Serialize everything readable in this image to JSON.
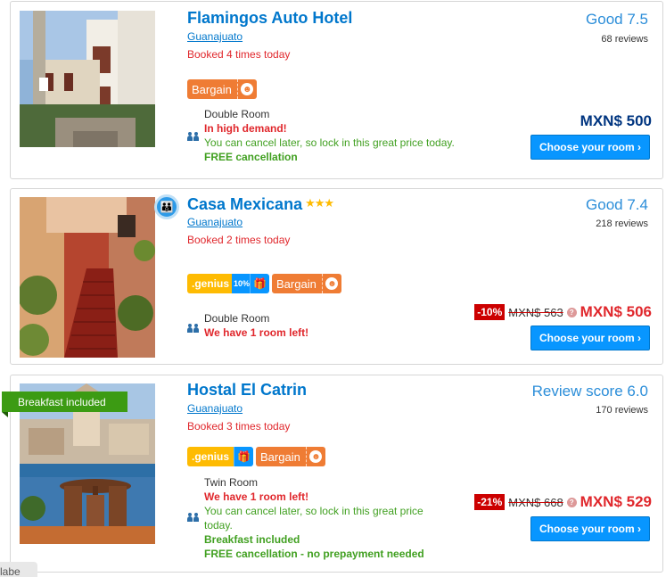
{
  "hotels": [
    {
      "name": "Flamingos Auto Hotel",
      "stars": "",
      "city": "Guanajuato",
      "booked": "Booked 4 times today",
      "score": "Good 7.5",
      "reviews": "68 reviews",
      "room_type": "Double Room",
      "line1": "In high demand!",
      "line2": "You can cancel later, so lock in this great price today.",
      "line3": "FREE cancellation",
      "price": "MXN$ 500",
      "button": "Choose your room ›",
      "bargain": "Bargain"
    },
    {
      "name": "Casa Mexicana",
      "stars": "★★★",
      "city": "Guanajuato",
      "booked": "Booked 2 times today",
      "score": "Good 7.4",
      "reviews": "218 reviews",
      "room_type": "Double Room",
      "line1": "We have 1 room left!",
      "discount": "-10%",
      "old_price": "MXN$ 563",
      "price": "MXN$ 506",
      "button": "Choose your room ›",
      "genius": ".genius",
      "genius_pct": "10%",
      "bargain": "Bargain"
    },
    {
      "name": "Hostal El Catrin",
      "stars": "",
      "city": "Guanajuato",
      "booked": "Booked 3 times today",
      "score": "Review score 6.0",
      "reviews": "170 reviews",
      "ribbon": "Breakfast included",
      "room_type": "Twin Room",
      "line1": "We have 1 room left!",
      "line2": "You can cancel later, so lock in this great price today.",
      "line3": "Breakfast included",
      "line4": "FREE cancellation - no prepayment needed",
      "discount": "-21%",
      "old_price": "MXN$ 668",
      "price": "MXN$ 529",
      "button": "Choose your room ›",
      "genius": ".genius",
      "bargain": "Bargain"
    }
  ],
  "bottom_tab": "labe",
  "colors": {
    "link_blue": "#0077cc",
    "urgent_red": "#e0272c",
    "green": "#41a021",
    "button_blue": "#0896ff",
    "bargain_orange": "#ef7c34",
    "genius_yellow": "#febb02",
    "ribbon_green": "#3c9b13"
  }
}
